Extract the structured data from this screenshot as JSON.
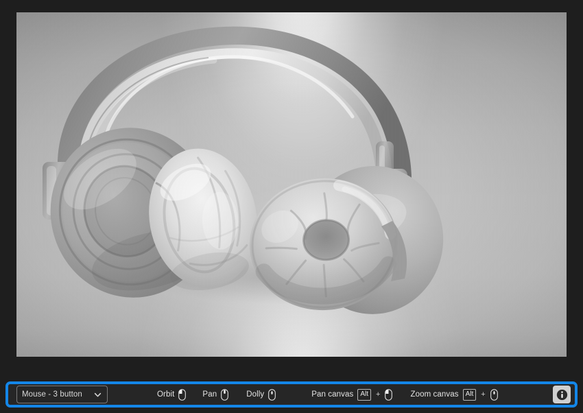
{
  "viewport": {
    "name": "3d-model-viewport",
    "model_subject": "over-ear headphones",
    "render_style": "untextured clay / grayscale shaded 3D render",
    "background_description": "neutral gray studio backdrop with a bright top-center light beam and a bottom-center bounce glow"
  },
  "toolbar": {
    "input_device_select": {
      "value": "Mouse - 3 button",
      "chevron_icon": "chevron-down-icon"
    },
    "navigation_hints": [
      {
        "label": "Orbit",
        "icon": "mouse-left-button-icon",
        "modifier": null
      },
      {
        "label": "Pan",
        "icon": "mouse-middle-button-icon",
        "modifier": null
      },
      {
        "label": "Dolly",
        "icon": "mouse-scroll-wheel-icon",
        "modifier": null
      }
    ],
    "canvas_hints": [
      {
        "label": "Pan canvas",
        "modifier": "Alt",
        "plus": "+",
        "icon": "mouse-left-button-icon"
      },
      {
        "label": "Zoom canvas",
        "modifier": "Alt",
        "plus": "+",
        "icon": "mouse-scroll-wheel-icon"
      }
    ],
    "info_button": {
      "icon": "info-icon",
      "glyph": "i"
    }
  },
  "colors": {
    "focus_ring": "#1486e8",
    "toolbar_background": "#262626",
    "app_background": "#1e1e1e",
    "label_text": "#e3e3e3",
    "select_border": "#7a7a7a",
    "info_button_background": "#d0d0d0"
  }
}
